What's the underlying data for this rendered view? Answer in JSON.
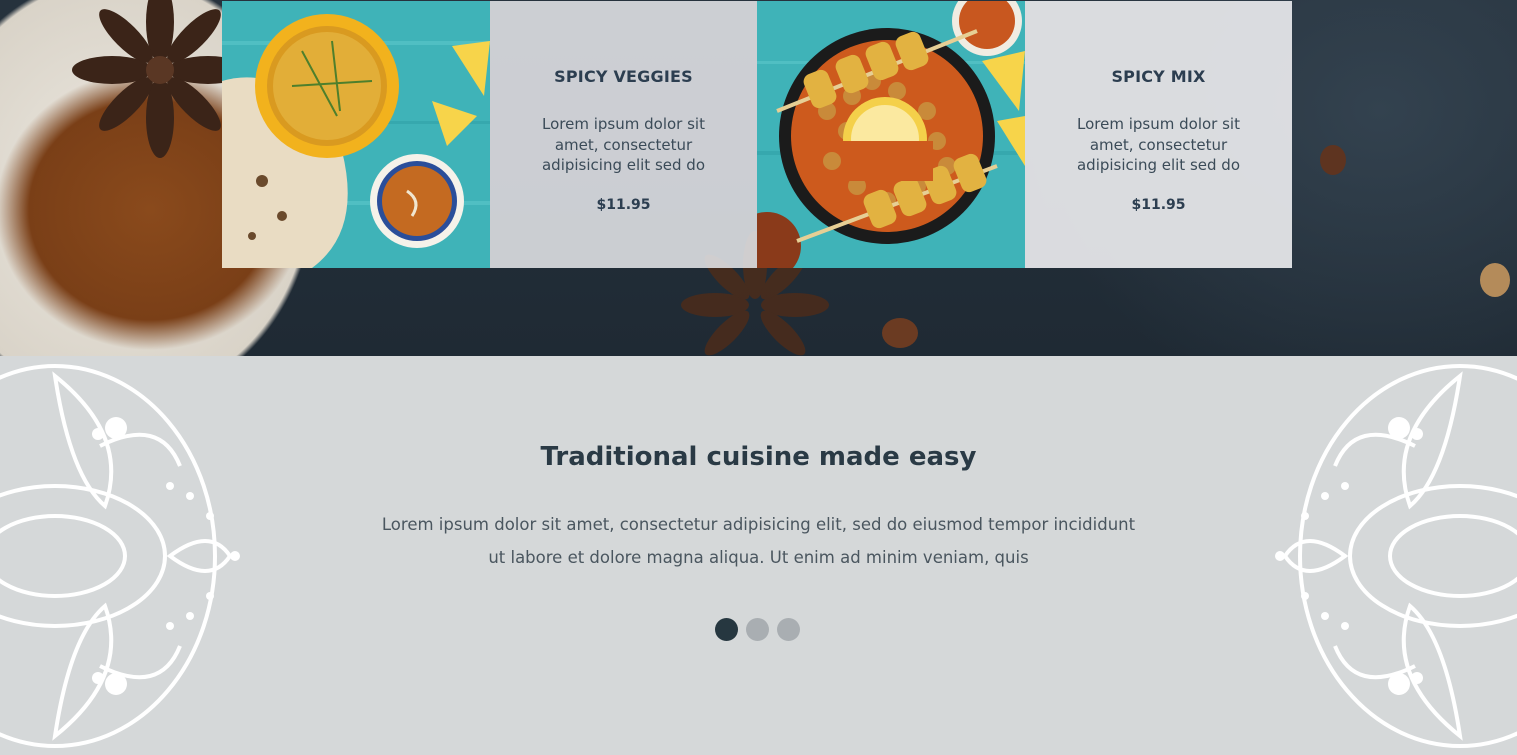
{
  "menu": {
    "items": [
      {
        "name": "SPICY VEGGIES",
        "description": "Lorem ipsum dolor sit amet, consectetur adipisicing elit sed do",
        "price": "$11.95",
        "photo": "rice-bowl-photo"
      },
      {
        "name": "SPICY MIX",
        "description": "Lorem ipsum dolor sit amet, consectetur adipisicing elit sed do",
        "price": "$11.95",
        "photo": "chickpea-skewer-photo"
      }
    ]
  },
  "about": {
    "title": "Traditional cuisine made easy",
    "text": "Lorem ipsum dolor sit amet, consectetur adipisicing elit, sed do eiusmod tempor incididunt ut labore et dolore magna aliqua. Ut enim ad minim veniam, quis"
  },
  "slider": {
    "count": 3,
    "active": 1
  },
  "colors": {
    "heading": "#2c3e50",
    "dot_active": "#263740",
    "dot_inactive": "#a9aeb2",
    "section_bg": "#d5d8d9"
  }
}
